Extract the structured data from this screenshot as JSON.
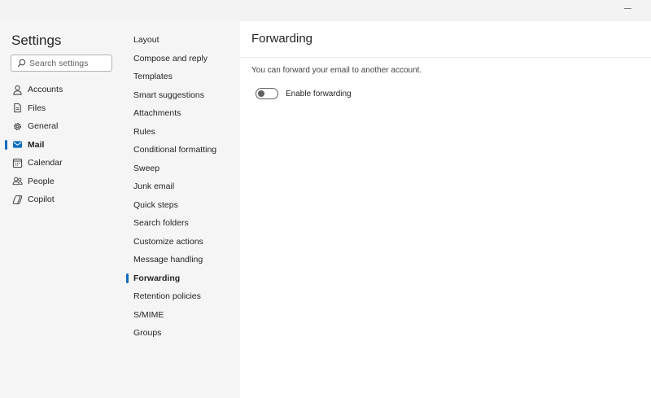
{
  "window": {
    "minimize_glyph": "—"
  },
  "sidebar": {
    "title": "Settings",
    "search_placeholder": "Search settings",
    "items": [
      {
        "label": "Accounts",
        "icon": "person-icon"
      },
      {
        "label": "Files",
        "icon": "document-icon"
      },
      {
        "label": "General",
        "icon": "gear-icon"
      },
      {
        "label": "Mail",
        "icon": "mail-icon",
        "selected": true
      },
      {
        "label": "Calendar",
        "icon": "calendar-icon"
      },
      {
        "label": "People",
        "icon": "people-icon"
      },
      {
        "label": "Copilot",
        "icon": "copilot-icon"
      }
    ]
  },
  "mail_nav": {
    "items": [
      "Layout",
      "Compose and reply",
      "Templates",
      "Smart suggestions",
      "Attachments",
      "Rules",
      "Conditional formatting",
      "Sweep",
      "Junk email",
      "Quick steps",
      "Search folders",
      "Customize actions",
      "Message handling",
      "Forwarding",
      "Retention policies",
      "S/MIME",
      "Groups"
    ],
    "selected": "Forwarding"
  },
  "content": {
    "title": "Forwarding",
    "description": "You can forward your email to another account.",
    "toggle_label": "Enable forwarding",
    "toggle_on": false
  },
  "colors": {
    "accent": "#0f6cbd",
    "pane_background": "#f5f5f5",
    "titlebar_background": "#f3f3f3"
  }
}
